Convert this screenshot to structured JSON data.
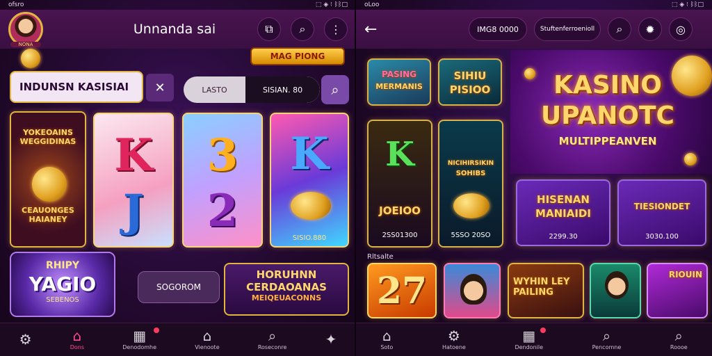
{
  "left": {
    "status": {
      "time": "ofsro",
      "icons": "⬚ ◈ ⁝ ᛒᛒ□"
    },
    "header": {
      "title": "Unnanda sai",
      "avatar_text": "NONA"
    },
    "banner": {
      "text": "MAG PIONG"
    },
    "search": {
      "value": "INDUNSN KASISIAI",
      "clear_icon": "close-icon"
    },
    "filter": {
      "left": "LASTO",
      "right": "SISIAN. 80"
    },
    "tiles": [
      {
        "title": "YOKEOAINS WEGGIDINAS",
        "sub": "CEAUONGES HAIANEY"
      },
      {
        "letters": [
          "K",
          "J"
        ]
      },
      {
        "letters": [
          "3",
          "2"
        ]
      },
      {
        "letters": [
          "K"
        ],
        "value": "SISIO.880"
      }
    ],
    "promo1": {
      "top": "RHIPY",
      "main": "YAGIO",
      "sub": "SEBENOS"
    },
    "mid_btn": "SOGOROM",
    "promo2": {
      "line1": "HORUHNN",
      "line2": "CERDAOANAS",
      "line3": "MEIQEUACONNS"
    },
    "nav": [
      {
        "label": "",
        "icon": "gear-icon"
      },
      {
        "label": "Dons",
        "icon": "home-icon",
        "active": true
      },
      {
        "label": "Denodomhe",
        "icon": "grid-icon",
        "badge": true
      },
      {
        "label": "Vienoote",
        "icon": "house-icon"
      },
      {
        "label": "Roseconre",
        "icon": "search-icon"
      },
      {
        "label": "",
        "icon": "puzzle-icon"
      }
    ]
  },
  "right": {
    "status": {
      "time": "oLoo",
      "icons": "⬚ ◈ ⁝ ᛒᛒ□"
    },
    "header": {
      "balance": "IMG8 0000",
      "pill": "Stuftenferroenioll"
    },
    "cards_top": [
      {
        "line1": "PASING",
        "line2": "MERMANIS"
      },
      {
        "line1": "SIHIU",
        "line2": "PISIOO"
      }
    ],
    "hero": {
      "line1": "KASINO",
      "line2": "UPANOTC",
      "line3": "MULTIPPEANVEN"
    },
    "cards_mid": [
      {
        "letter": "K",
        "label": "JOEIOO",
        "value": "2SS01300"
      },
      {
        "line1": "NICIHIRSIKIN",
        "line2": "SOHIBS",
        "value": "5SSO 20SO"
      }
    ],
    "cards_mid2": [
      {
        "line1": "HISENAN",
        "line2": "MANIAIDI",
        "value": "2299.30"
      },
      {
        "line1": "TIESIONDET",
        "value": "3030.100"
      }
    ],
    "section_label": "Rltsalte",
    "thumbs": [
      {
        "text": "27"
      },
      {
        "text": ""
      },
      {
        "text": "WYHIN LEY PAILING"
      },
      {
        "text": ""
      },
      {
        "text": "RIOUIN"
      }
    ],
    "nav": [
      {
        "label": "Soto",
        "icon": "home-icon"
      },
      {
        "label": "Hatoene",
        "icon": "gear-icon"
      },
      {
        "label": "Dendonile",
        "icon": "grid-icon",
        "badge": true
      },
      {
        "label": "Pencomne",
        "icon": "search-icon"
      },
      {
        "label": "Roooe",
        "icon": "search-icon"
      }
    ]
  },
  "colors": {
    "accent": "#ff4d8d",
    "gold": "#e0b540",
    "bg": "#23092f"
  }
}
